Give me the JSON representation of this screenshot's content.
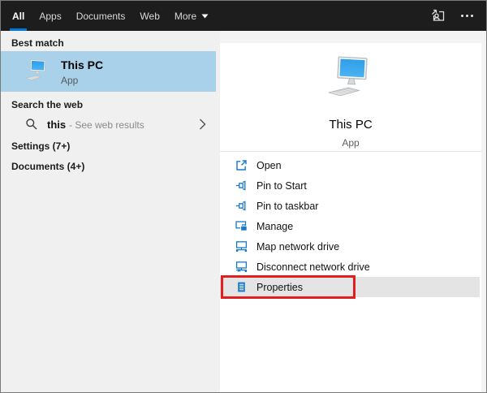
{
  "topbar": {
    "tabs": [
      {
        "label": "All",
        "active": true
      },
      {
        "label": "Apps",
        "active": false
      },
      {
        "label": "Documents",
        "active": false
      },
      {
        "label": "Web",
        "active": false
      },
      {
        "label": "More",
        "active": false,
        "has_dropdown": true
      }
    ],
    "right_icons": [
      "sign-in-icon",
      "more-options-icon"
    ]
  },
  "left": {
    "best_match_header": "Best match",
    "best_match": {
      "title": "This PC",
      "subtitle": "App",
      "icon": "this-pc-icon"
    },
    "search_web_header": "Search the web",
    "search_row": {
      "query": "this",
      "hint": "- See web results",
      "icon": "search-icon",
      "chevron": "chevron-right-icon"
    },
    "settings_header": "Settings (7+)",
    "documents_header": "Documents (4+)"
  },
  "right": {
    "hero": {
      "title": "This PC",
      "subtitle": "App",
      "icon": "this-pc-icon-large"
    },
    "actions": [
      {
        "label": "Open",
        "icon": "open-icon"
      },
      {
        "label": "Pin to Start",
        "icon": "pin-icon"
      },
      {
        "label": "Pin to taskbar",
        "icon": "pin-icon"
      },
      {
        "label": "Manage",
        "icon": "manage-icon"
      },
      {
        "label": "Map network drive",
        "icon": "map-network-drive-icon"
      },
      {
        "label": "Disconnect network drive",
        "icon": "disconnect-network-drive-icon"
      },
      {
        "label": "Properties",
        "icon": "properties-icon",
        "highlighted": true,
        "annotated": true
      }
    ]
  },
  "colors": {
    "accent": "#0078d7",
    "icon_blue": "#1979ca",
    "best_match_highlight": "#a9d2ea",
    "hover_gray": "#e4e4e4",
    "annotation_red": "#e31e1e",
    "topbar_bg": "#1d1d1d"
  }
}
